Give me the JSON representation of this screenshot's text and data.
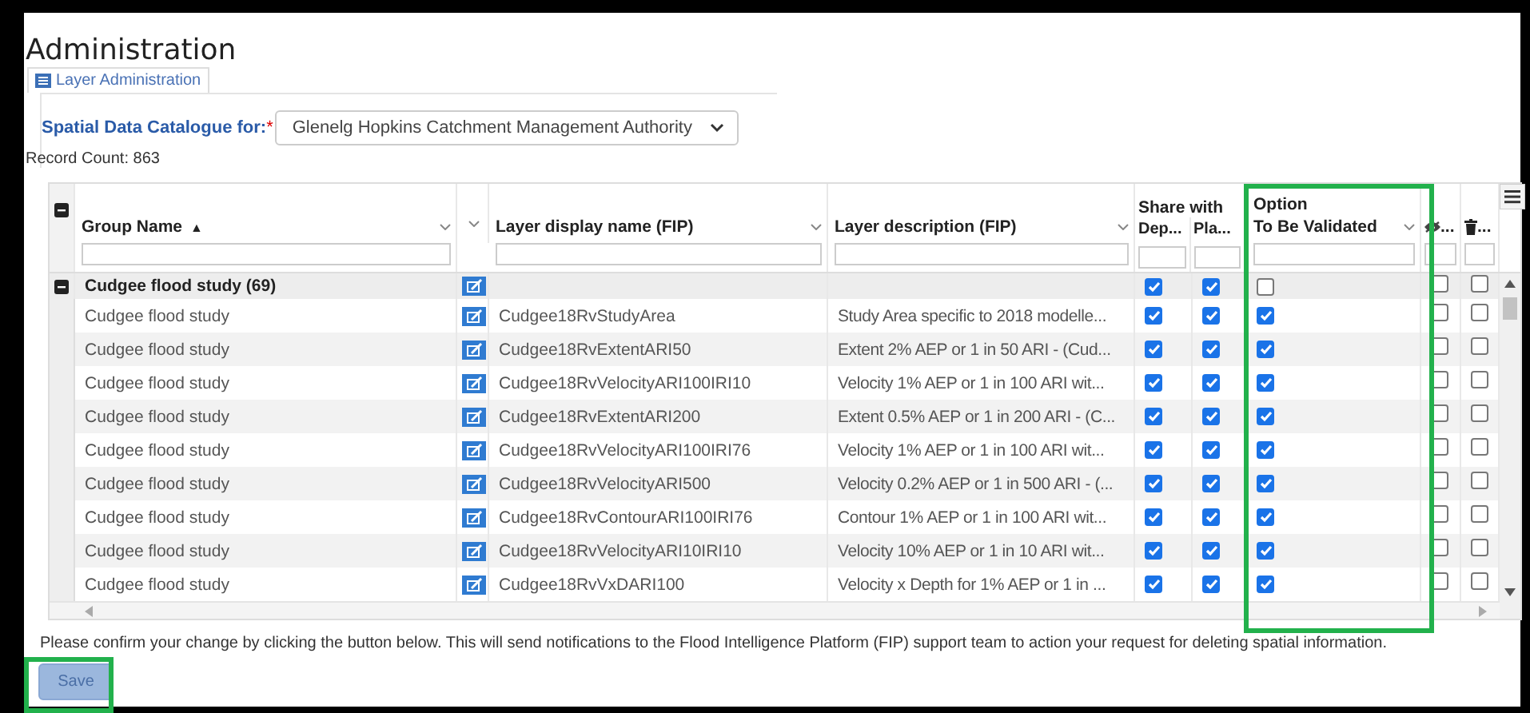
{
  "page_title": "Administration",
  "tab": {
    "label": "Layer Administration"
  },
  "catalogue": {
    "label": "Spatial Data Catalogue for:",
    "required_mark": "*",
    "value": "Glenelg Hopkins Catchment Management Authority"
  },
  "record_count": "Record Count: 863",
  "table": {
    "column_groups": [
      "Share with",
      "Option"
    ],
    "columns": [
      {
        "label": "Group Name",
        "sort_icon": "▲"
      },
      {
        "label": "Layer display name (FIP)"
      },
      {
        "label": "Layer description (FIP)"
      },
      {
        "label": "Dep..."
      },
      {
        "label": "Pla..."
      },
      {
        "label": "To Be Validated"
      },
      {
        "label": "..."
      },
      {
        "label": "..."
      }
    ],
    "group_row": {
      "label": "Cudgee flood study (69)",
      "expanded": true,
      "share_dep": true,
      "share_pla": true,
      "to_be_validated": false,
      "hidden": false,
      "delete": false
    },
    "rows": [
      {
        "group": "Cudgee flood study",
        "name": "Cudgee18RvStudyArea",
        "description": "Study Area specific to 2018 modelle...",
        "share_dep": true,
        "share_pla": true,
        "to_be_validated": true,
        "hidden": false,
        "delete": false
      },
      {
        "group": "Cudgee flood study",
        "name": "Cudgee18RvExtentARI50",
        "description": "Extent 2% AEP or 1 in 50 ARI - (Cud...",
        "share_dep": true,
        "share_pla": true,
        "to_be_validated": true,
        "hidden": false,
        "delete": false
      },
      {
        "group": "Cudgee flood study",
        "name": "Cudgee18RvVelocityARI100IRI10",
        "description": "Velocity 1% AEP or 1 in 100 ARI wit...",
        "share_dep": true,
        "share_pla": true,
        "to_be_validated": true,
        "hidden": false,
        "delete": false
      },
      {
        "group": "Cudgee flood study",
        "name": "Cudgee18RvExtentARI200",
        "description": "Extent 0.5% AEP or 1 in 200 ARI - (C...",
        "share_dep": true,
        "share_pla": true,
        "to_be_validated": true,
        "hidden": false,
        "delete": false
      },
      {
        "group": "Cudgee flood study",
        "name": "Cudgee18RvVelocityARI100IRI76",
        "description": "Velocity 1% AEP or 1 in 100 ARI wit...",
        "share_dep": true,
        "share_pla": true,
        "to_be_validated": true,
        "hidden": false,
        "delete": false
      },
      {
        "group": "Cudgee flood study",
        "name": "Cudgee18RvVelocityARI500",
        "description": "Velocity 0.2% AEP or 1 in 500 ARI - (...",
        "share_dep": true,
        "share_pla": true,
        "to_be_validated": true,
        "hidden": false,
        "delete": false
      },
      {
        "group": "Cudgee flood study",
        "name": "Cudgee18RvContourARI100IRI76",
        "description": "Contour 1% AEP or 1 in 100 ARI wit...",
        "share_dep": true,
        "share_pla": true,
        "to_be_validated": true,
        "hidden": false,
        "delete": false
      },
      {
        "group": "Cudgee flood study",
        "name": "Cudgee18RvVelocityARI10IRI10",
        "description": "Velocity 10% AEP or 1 in 10 ARI wit...",
        "share_dep": true,
        "share_pla": true,
        "to_be_validated": true,
        "hidden": false,
        "delete": false
      },
      {
        "group": "Cudgee flood study",
        "name": "Cudgee18RvVxDARI100",
        "description": "Velocity x Depth for 1% AEP or 1 in ...",
        "share_dep": true,
        "share_pla": true,
        "to_be_validated": true,
        "hidden": false,
        "delete": false
      }
    ]
  },
  "notice": "Please confirm your change by clicking the button below. This will send notifications to the Flood Intelligence Platform (FIP) support team to action your request for deleting spatial information.",
  "save_button": "Save"
}
